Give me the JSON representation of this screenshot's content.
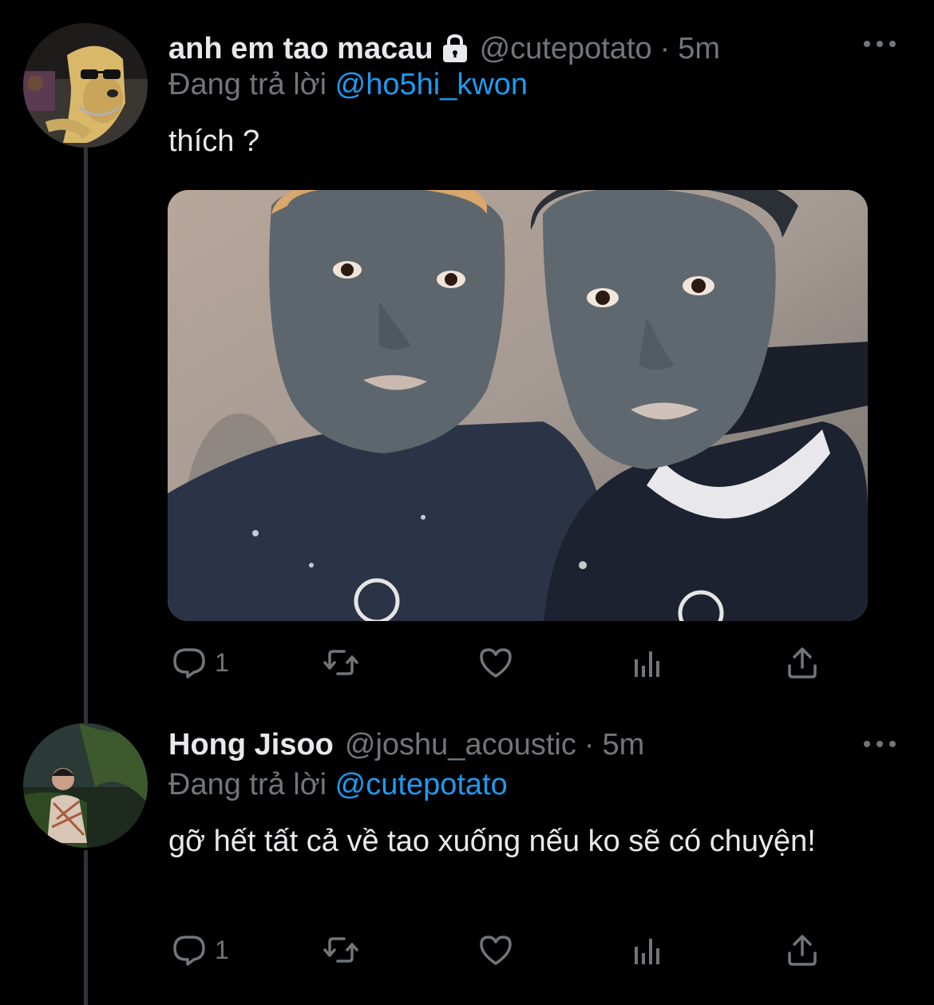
{
  "tweets": [
    {
      "display_name": "anh em tao macau",
      "protected": true,
      "handle": "@cutepotato",
      "separator": "·",
      "time": "5m",
      "reply_prefix": "Đang trả lời",
      "reply_mention": "@ho5hi_kwon",
      "text": "thích ?",
      "has_media": true,
      "reply_count": "1"
    },
    {
      "display_name": "Hong Jisoo",
      "protected": false,
      "handle": "@joshu_acoustic",
      "separator": "·",
      "time": "5m",
      "reply_prefix": "Đang trả lời",
      "reply_mention": "@cutepotato",
      "text": "gỡ hết tất cả về tao xuống nếu ko sẽ có chuyện!",
      "has_media": false,
      "reply_count": "1"
    }
  ],
  "icons": {
    "reply": "reply-icon",
    "retweet": "retweet-icon",
    "like": "heart-icon",
    "views": "views-icon",
    "share": "share-icon",
    "more": "more-icon",
    "lock": "lock-icon"
  },
  "colors": {
    "background": "#000000",
    "primary_text": "#e7e9ea",
    "secondary_text": "#71767b",
    "link": "#1d9bf0",
    "thread_line": "#2f3336"
  }
}
